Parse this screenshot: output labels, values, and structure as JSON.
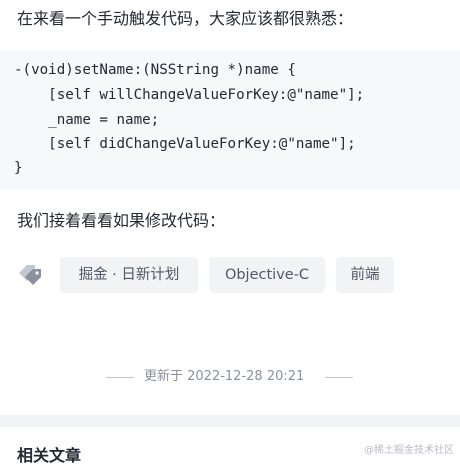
{
  "article": {
    "intro_text": "在来看一个手动触发代码，大家应该都很熟悉：",
    "code_lines": [
      "-(void)setName:(NSString *)name {",
      "    [self willChangeValueForKey:@\"name\"];",
      "    _name = name;",
      "    [self didChangeValueForKey:@\"name\"];",
      "}"
    ],
    "second_text": "我们接着看看如果修改代码："
  },
  "tags": {
    "icon": "tag-icon",
    "items": [
      "掘金 · 日新计划",
      "Objective-C",
      "前端"
    ]
  },
  "meta": {
    "updated_text": "更新于 2022-12-28 20:21"
  },
  "related": {
    "title": "相关文章"
  },
  "watermark": {
    "text": "@稀土掘金技术社区"
  },
  "colors": {
    "code_background": "#f6f8fa",
    "tag_background": "#f2f3f5",
    "tag_text": "#515767",
    "muted_text": "#8a919f"
  }
}
